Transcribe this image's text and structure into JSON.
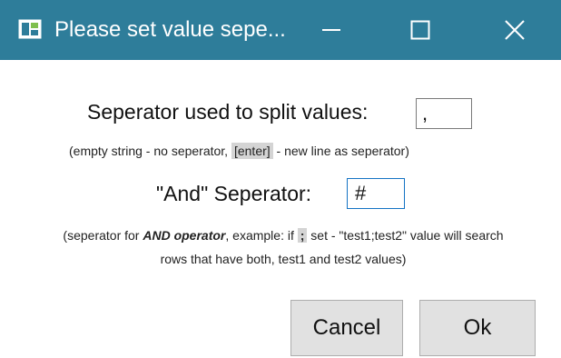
{
  "window": {
    "title": "Please set value sepe...",
    "title_bar_color": "#2e7d9a",
    "controls": {
      "minimize_icon": "minimize-icon",
      "maximize_icon": "maximize-icon",
      "close_icon": "close-icon"
    }
  },
  "separator": {
    "label": "Seperator used to split values:",
    "value": ",",
    "hint_prefix": "(empty string - no seperator, ",
    "hint_key": "[enter]",
    "hint_suffix": " - new line as seperator)"
  },
  "and_separator": {
    "label": "\"And\" Seperator:",
    "value": "#",
    "hint_line1_prefix": "(seperator for ",
    "hint_line1_bold": "AND operator",
    "hint_line1_mid": ", example: if ",
    "hint_line1_code": ";",
    "hint_line1_suffix": " set - \"test1;test2\" value will search",
    "hint_line2": "rows that have both, test1 and test2 values)"
  },
  "buttons": {
    "cancel_label": "Cancel",
    "ok_label": "Ok"
  }
}
